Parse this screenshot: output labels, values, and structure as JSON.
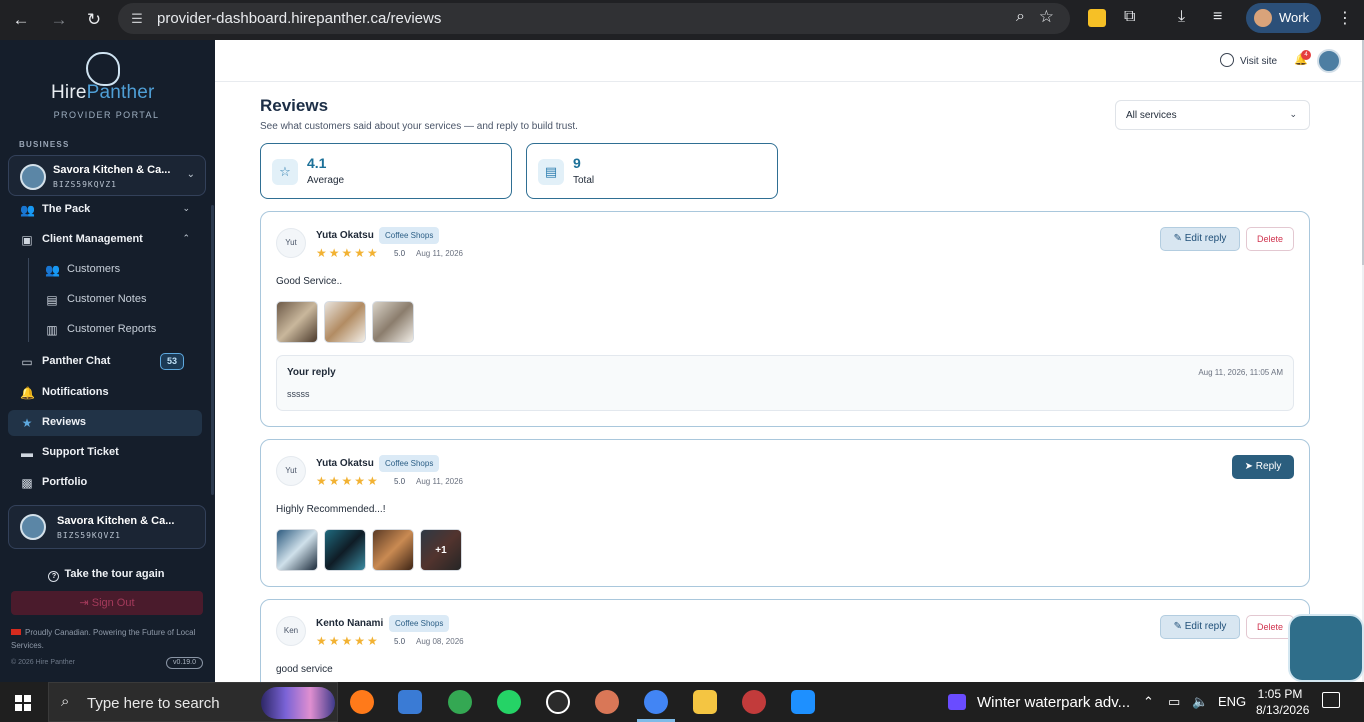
{
  "browser": {
    "url": "provider-dashboard.hirepanther.ca/reviews",
    "profile_label": "Work"
  },
  "sidebar": {
    "logo_word1": "Hire",
    "logo_word2": "Panther",
    "portal_label": "PROVIDER PORTAL",
    "section_label": "BUSINESS",
    "business_name": "Savora Kitchen & Ca...",
    "business_code": "BIZS59KQVZ1",
    "items": [
      {
        "label": "The Pack",
        "icon": "group-icon"
      },
      {
        "label": "Client Management",
        "icon": "contact-icon"
      },
      {
        "label": "Customers",
        "icon": "people-icon"
      },
      {
        "label": "Customer Notes",
        "icon": "note-icon"
      },
      {
        "label": "Customer Reports",
        "icon": "bar-chart-icon"
      },
      {
        "label": "Panther Chat",
        "icon": "chat-icon",
        "badge": "53"
      },
      {
        "label": "Notifications",
        "icon": "bell-icon"
      },
      {
        "label": "Reviews",
        "icon": "star-icon",
        "active": true
      },
      {
        "label": "Support Ticket",
        "icon": "ticket-icon"
      },
      {
        "label": "Portfolio",
        "icon": "briefcase-icon"
      }
    ],
    "bottom_business_name": "Savora Kitchen & Ca...",
    "bottom_business_code": "BIZS59KQVZ1",
    "tour_label": "Take the tour again",
    "signout_label": "Sign Out",
    "footer_text": "Proudly Canadian. Powering the Future of Local Services.",
    "copyright": "© 2026 Hire Panther",
    "version": "v0.19.0"
  },
  "topbar": {
    "visit_label": "Visit site",
    "notif_count": "4"
  },
  "page": {
    "title": "Reviews",
    "subtitle": "See what customers said about your services — and reply to build trust.",
    "service_filter": "All services",
    "stats": {
      "average_value": "4.1",
      "average_label": "Average",
      "total_value": "9",
      "total_label": "Total"
    }
  },
  "reviews": [
    {
      "initials": "Yut",
      "name": "Yuta Okatsu",
      "tag": "Coffee Shops",
      "score": "5.0",
      "date": "Aug 11, 2026",
      "text": "Good Service..",
      "edit_label": "Edit reply",
      "delete_label": "Delete",
      "reply_heading": "Your reply",
      "reply_time": "Aug 11, 2026, 11:05 AM",
      "reply_text": "sssss"
    },
    {
      "initials": "Yut",
      "name": "Yuta Okatsu",
      "tag": "Coffee Shops",
      "score": "5.0",
      "date": "Aug 11, 2026",
      "text": "Highly Recommended...!",
      "reply_label": "Reply",
      "more_photos": "+1"
    },
    {
      "initials": "Ken",
      "name": "Kento Nanami",
      "tag": "Coffee Shops",
      "score": "5.0",
      "date": "Aug 08, 2026",
      "text": "good service",
      "edit_label": "Edit reply",
      "delete_label": "Delete"
    }
  ],
  "taskbar": {
    "search_placeholder": "Type here to search",
    "window_title": "Winter waterpark adv...",
    "lang": "ENG",
    "time": "1:05 PM",
    "date": "8/13/2026"
  },
  "colors": {
    "sidebar_bg": "#151e2b",
    "accent": "#2b5e7e",
    "star": "#f2b233"
  }
}
